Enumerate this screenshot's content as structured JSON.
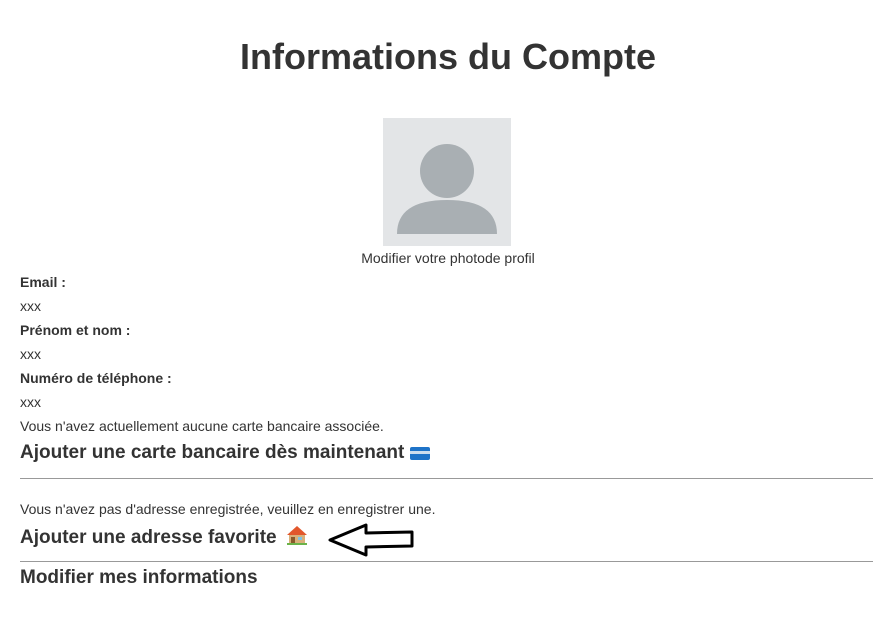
{
  "title": "Informations du Compte",
  "profile": {
    "edit_photo": "Modifier votre photode profil"
  },
  "fields": [
    {
      "label": "Email :",
      "value": "xxx"
    },
    {
      "label": "Prénom et nom :",
      "value": "xxx"
    },
    {
      "label": "Numéro de téléphone :",
      "value": "xxx"
    }
  ],
  "card": {
    "notice": "Vous n'avez actuellement aucune carte bancaire associée.",
    "link": "Ajouter une carte bancaire dès maintenant",
    "icon": "credit-card-icon"
  },
  "address": {
    "notice": "Vous n'avez pas d'adresse enregistrée, veuillez en enregistrer une.",
    "link": "Ajouter une adresse favorite",
    "icon": "house-icon"
  },
  "edit_info": "Modifier mes informations"
}
